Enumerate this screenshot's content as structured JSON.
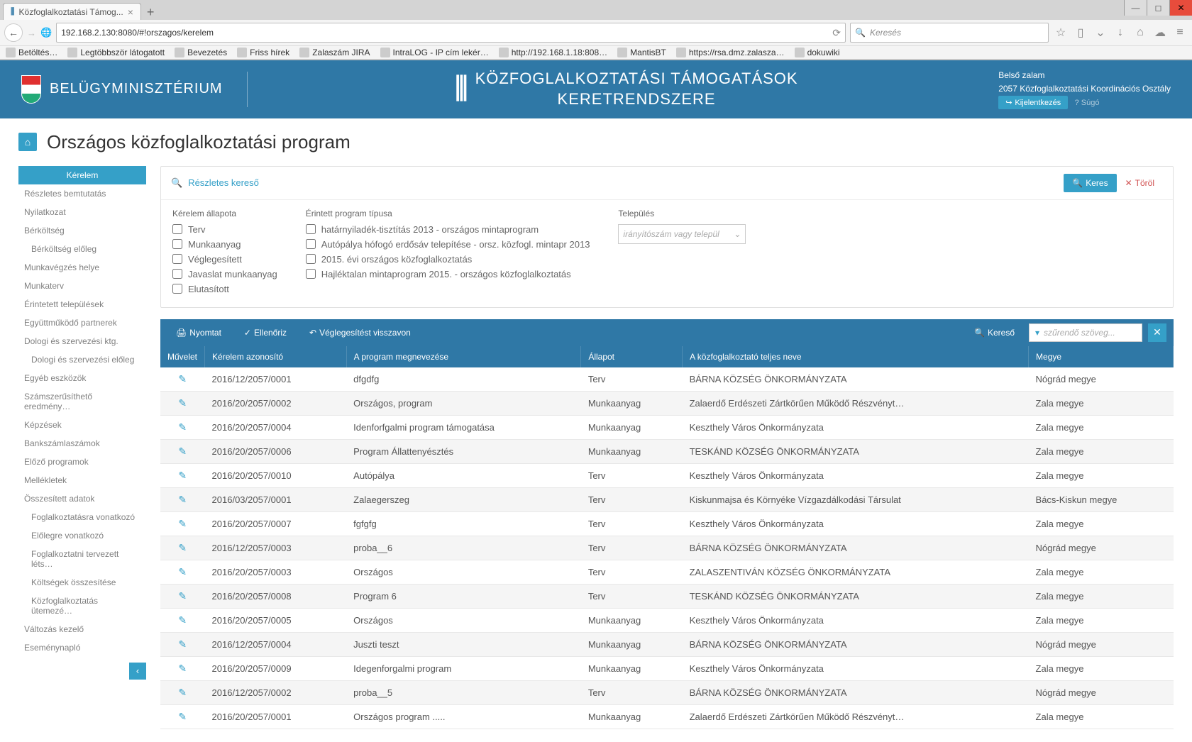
{
  "browser": {
    "tab_title": "Közfoglalkoztatási Támog...",
    "url": "192.168.2.130:8080/#!orszagos/kerelem",
    "search_placeholder": "Keresés",
    "bookmarks": [
      "Betöltés…",
      "Legtöbbször látogatott",
      "Bevezetés",
      "Friss hírek",
      "Zalaszám JIRA",
      "IntraLOG - IP cím lekér…",
      "http://192.168.1.18:808…",
      "MantisBT",
      "https://rsa.dmz.zalasza…",
      "dokuwiki"
    ]
  },
  "header": {
    "ministry": "BELÜGYMINISZTÉRIUM",
    "app_title_1": "KÖZFOGLALKOZTATÁSI TÁMOGATÁSOK",
    "app_title_2": "KERETRENDSZERE",
    "user": "Belső zalam",
    "org": "2057 Közfoglalkoztatási Koordinációs Osztály",
    "logout": "Kijelentkezés",
    "help": "? Súgó"
  },
  "page": {
    "title": "Országos közfoglalkoztatási program"
  },
  "sidebar": [
    {
      "label": "Kérelem",
      "active": true
    },
    {
      "label": "Részletes bemtutatás"
    },
    {
      "label": "Nyilatkozat"
    },
    {
      "label": "Bérköltség"
    },
    {
      "label": "Bérköltség előleg",
      "sub": true
    },
    {
      "label": "Munkavégzés helye"
    },
    {
      "label": "Munkaterv"
    },
    {
      "label": "Érintetett települések"
    },
    {
      "label": "Együttműködő partnerek"
    },
    {
      "label": "Dologi és szervezési ktg."
    },
    {
      "label": "Dologi és szervezési előleg",
      "sub": true
    },
    {
      "label": "Egyéb eszközök"
    },
    {
      "label": "Számszerűsíthető eredmény…"
    },
    {
      "label": "Képzések"
    },
    {
      "label": "Bankszámlaszámok"
    },
    {
      "label": "Előző programok"
    },
    {
      "label": "Mellékletek"
    },
    {
      "label": "Összesített adatok"
    },
    {
      "label": "Foglalkoztatásra vonatkozó",
      "sub": true
    },
    {
      "label": "Előlegre vonatkozó",
      "sub": true
    },
    {
      "label": "Foglalkoztatni tervezett léts…",
      "sub": true
    },
    {
      "label": "Költségek összesítése",
      "sub": true
    },
    {
      "label": "Közfoglalkoztatás ütemezé…",
      "sub": true
    },
    {
      "label": "Változás kezelő"
    },
    {
      "label": "Eseménynapló"
    }
  ],
  "search": {
    "expand_label": "Részletes kereső",
    "btn_search": "Keres",
    "btn_clear": "Töröl",
    "status_header": "Kérelem állapota",
    "statuses": [
      "Terv",
      "Munkaanyag",
      "Véglegesített",
      "Javaslat munkaanyag",
      "Elutasított"
    ],
    "program_header": "Érintett program típusa",
    "programs": [
      "határnyiladék-tisztítás 2013 - országos mintaprogram",
      "Autópálya hófogó erdősáv telepítése - orsz. közfogl. mintapr 2013",
      "2015. évi országos közfoglalkoztatás",
      "Hajléktalan mintaprogram 2015. - országos közfoglalkoztatás"
    ],
    "settlement_header": "Település",
    "settlement_placeholder": "irányítószám vagy települ"
  },
  "actions": {
    "print": "Nyomtat",
    "check": "Ellenőriz",
    "revoke": "Véglegesítést visszavon",
    "search": "Kereső",
    "filter_placeholder": "szűrendő szöveg..."
  },
  "table": {
    "headers": [
      "Művelet",
      "Kérelem azonosító",
      "A program megnevezése",
      "Állapot",
      "A közfoglalkoztató teljes neve",
      "Megye"
    ],
    "rows": [
      {
        "id": "2016/12/2057/0001",
        "prog": "dfgdfg",
        "status": "Terv",
        "org": "BÁRNA KÖZSÉG ÖNKORMÁNYZATA",
        "county": "Nógrád megye"
      },
      {
        "id": "2016/20/2057/0002",
        "prog": "Országos, program",
        "status": "Munkaanyag",
        "org": "Zalaerdő Erdészeti Zártkörűen Működő Részvényt…",
        "county": "Zala megye"
      },
      {
        "id": "2016/20/2057/0004",
        "prog": "Idenforfgalmi program támogatása",
        "status": "Munkaanyag",
        "org": "Keszthely Város Önkormányzata",
        "county": "Zala megye"
      },
      {
        "id": "2016/20/2057/0006",
        "prog": "Program Állattenyésztés",
        "status": "Munkaanyag",
        "org": "TESKÁND KÖZSÉG ÖNKORMÁNYZATA",
        "county": "Zala megye"
      },
      {
        "id": "2016/20/2057/0010",
        "prog": "Autópálya",
        "status": "Terv",
        "org": "Keszthely Város Önkormányzata",
        "county": "Zala megye"
      },
      {
        "id": "2016/03/2057/0001",
        "prog": "Zalaegerszeg",
        "status": "Terv",
        "org": "Kiskunmajsa és Környéke Vízgazdálkodási Társulat",
        "county": "Bács-Kiskun megye"
      },
      {
        "id": "2016/20/2057/0007",
        "prog": "fgfgfg",
        "status": "Terv",
        "org": "Keszthely Város Önkormányzata",
        "county": "Zala megye"
      },
      {
        "id": "2016/12/2057/0003",
        "prog": "proba__6",
        "status": "Terv",
        "org": "BÁRNA KÖZSÉG ÖNKORMÁNYZATA",
        "county": "Nógrád megye"
      },
      {
        "id": "2016/20/2057/0003",
        "prog": "Országos",
        "status": "Terv",
        "org": "ZALASZENTIVÁN KÖZSÉG ÖNKORMÁNYZATA",
        "county": "Zala megye"
      },
      {
        "id": "2016/20/2057/0008",
        "prog": "Program 6",
        "status": "Terv",
        "org": "TESKÁND KÖZSÉG ÖNKORMÁNYZATA",
        "county": "Zala megye"
      },
      {
        "id": "2016/20/2057/0005",
        "prog": "Országos",
        "status": "Munkaanyag",
        "org": "Keszthely Város Önkormányzata",
        "county": "Zala megye"
      },
      {
        "id": "2016/12/2057/0004",
        "prog": "Juszti teszt",
        "status": "Munkaanyag",
        "org": "BÁRNA KÖZSÉG ÖNKORMÁNYZATA",
        "county": "Nógrád megye"
      },
      {
        "id": "2016/20/2057/0009",
        "prog": "Idegenforgalmi program",
        "status": "Munkaanyag",
        "org": "Keszthely Város Önkormányzata",
        "county": "Zala megye"
      },
      {
        "id": "2016/12/2057/0002",
        "prog": "proba__5",
        "status": "Terv",
        "org": "BÁRNA KÖZSÉG ÖNKORMÁNYZATA",
        "county": "Nógrád megye"
      },
      {
        "id": "2016/20/2057/0001",
        "prog": "Országos program .....",
        "status": "Munkaanyag",
        "org": "Zalaerdő Erdészeti Zártkörűen Működő Részvényt…",
        "county": "Zala megye"
      }
    ]
  }
}
